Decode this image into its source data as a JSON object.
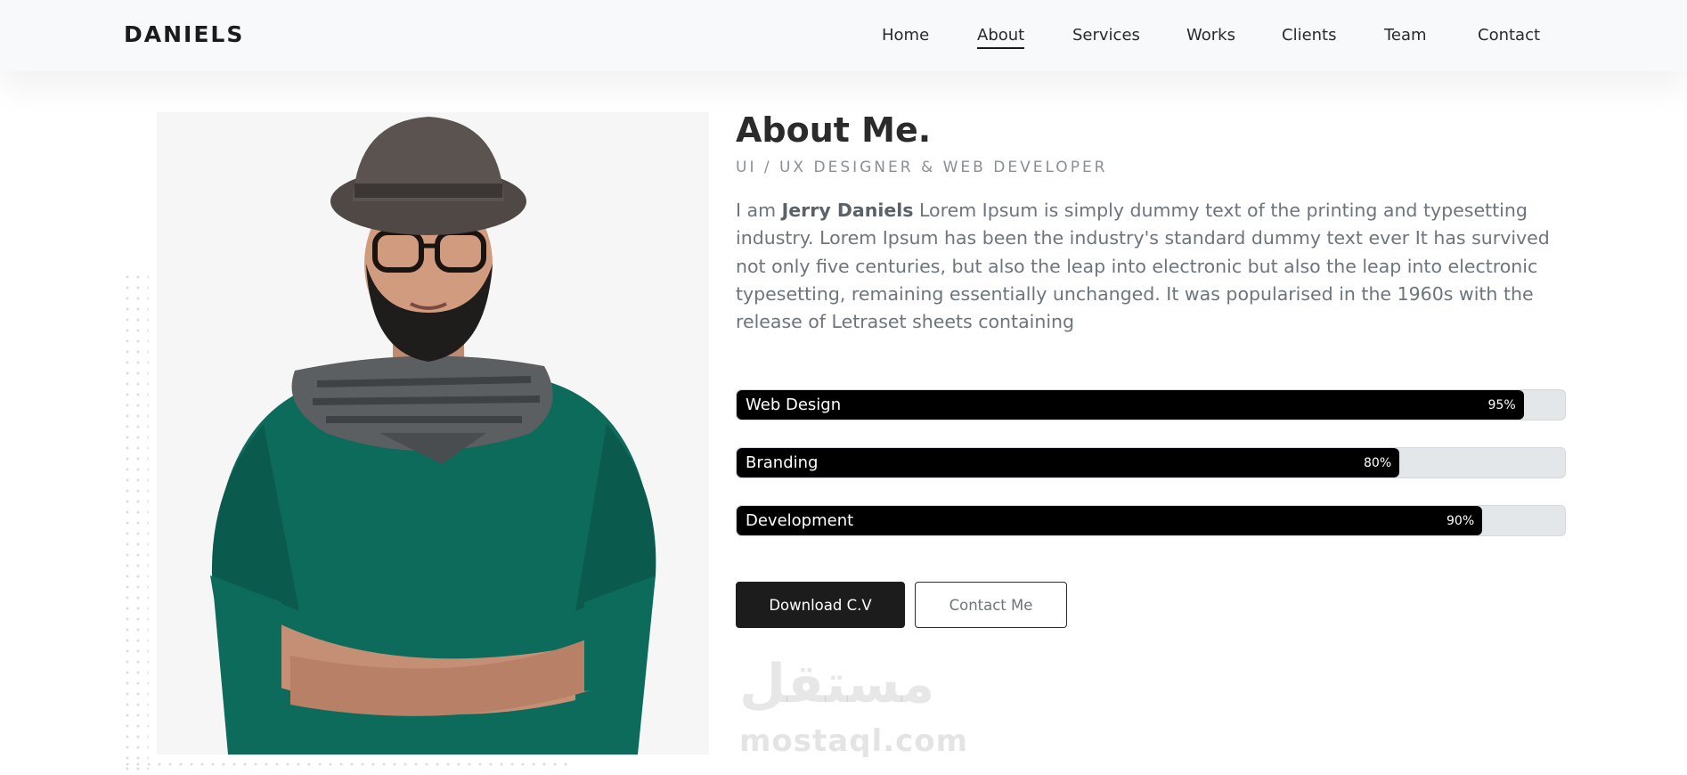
{
  "header": {
    "logo": "DANIELS",
    "nav": [
      {
        "label": "Home",
        "active": false
      },
      {
        "label": "About",
        "active": true
      },
      {
        "label": "Services",
        "active": false
      },
      {
        "label": "Works",
        "active": false
      },
      {
        "label": "Clients",
        "active": false
      },
      {
        "label": "Team",
        "active": false
      },
      {
        "label": "Contact",
        "active": false
      }
    ]
  },
  "about": {
    "title": "About Me.",
    "subtitle": "UI / UX DESIGNER & WEB DEVELOPER",
    "bio_prefix": "I am ",
    "bio_name": "Jerry Daniels",
    "bio_text": " Lorem Ipsum is simply dummy text of the printing and typesetting industry. Lorem Ipsum has been the industry's standard dummy text ever It has survived not only five centuries, but also the leap into electronic but also the leap into electronic typesetting, remaining essentially unchanged. It was popularised in the 1960s with the release of Letraset sheets containing"
  },
  "skills": [
    {
      "name": "Web Design",
      "percent_label": "95%",
      "value": 95
    },
    {
      "name": "Branding",
      "percent_label": "80%",
      "value": 80
    },
    {
      "name": "Development",
      "percent_label": "90%",
      "value": 90
    }
  ],
  "buttons": {
    "download": "Download C.V",
    "contact": "Contact Me"
  },
  "watermark": {
    "arabic": "مستقل",
    "latin": "mostaql.com"
  },
  "colors": {
    "skill_fill": "#000000",
    "skill_track": "#e4e7ea",
    "sweater": "#0d6b5c"
  }
}
